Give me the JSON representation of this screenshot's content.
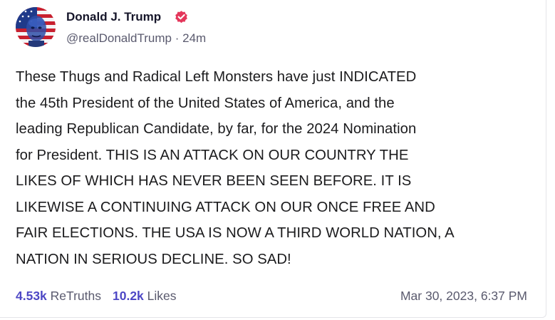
{
  "author": {
    "display_name": "Donald J. Trump",
    "handle": "@realDonaldTrump",
    "separator": "·",
    "relative_time": "24m",
    "verified_badge_color": "#e4375b",
    "avatar_icon": "flag-portrait-avatar"
  },
  "post": {
    "text": "These Thugs and Radical Left Monsters have just INDICATED\nthe 45th President of the United States of America, and the\nleading Republican Candidate, by far, for the 2024 Nomination\nfor President. THIS IS AN ATTACK ON OUR COUNTRY THE\nLIKES OF WHICH HAS NEVER BEEN SEEN BEFORE. IT IS\nLIKEWISE A CONTINUING ATTACK ON OUR ONCE FREE AND\nFAIR ELECTIONS. THE USA IS NOW A THIRD WORLD NATION, A\nNATION IN SERIOUS DECLINE. SO SAD!"
  },
  "stats": {
    "retruths_count": "4.53k",
    "retruths_label": "ReTruths",
    "likes_count": "10.2k",
    "likes_label": "Likes",
    "accent_color": "#4d47c5"
  },
  "timestamp": "Mar 30, 2023, 6:37 PM"
}
